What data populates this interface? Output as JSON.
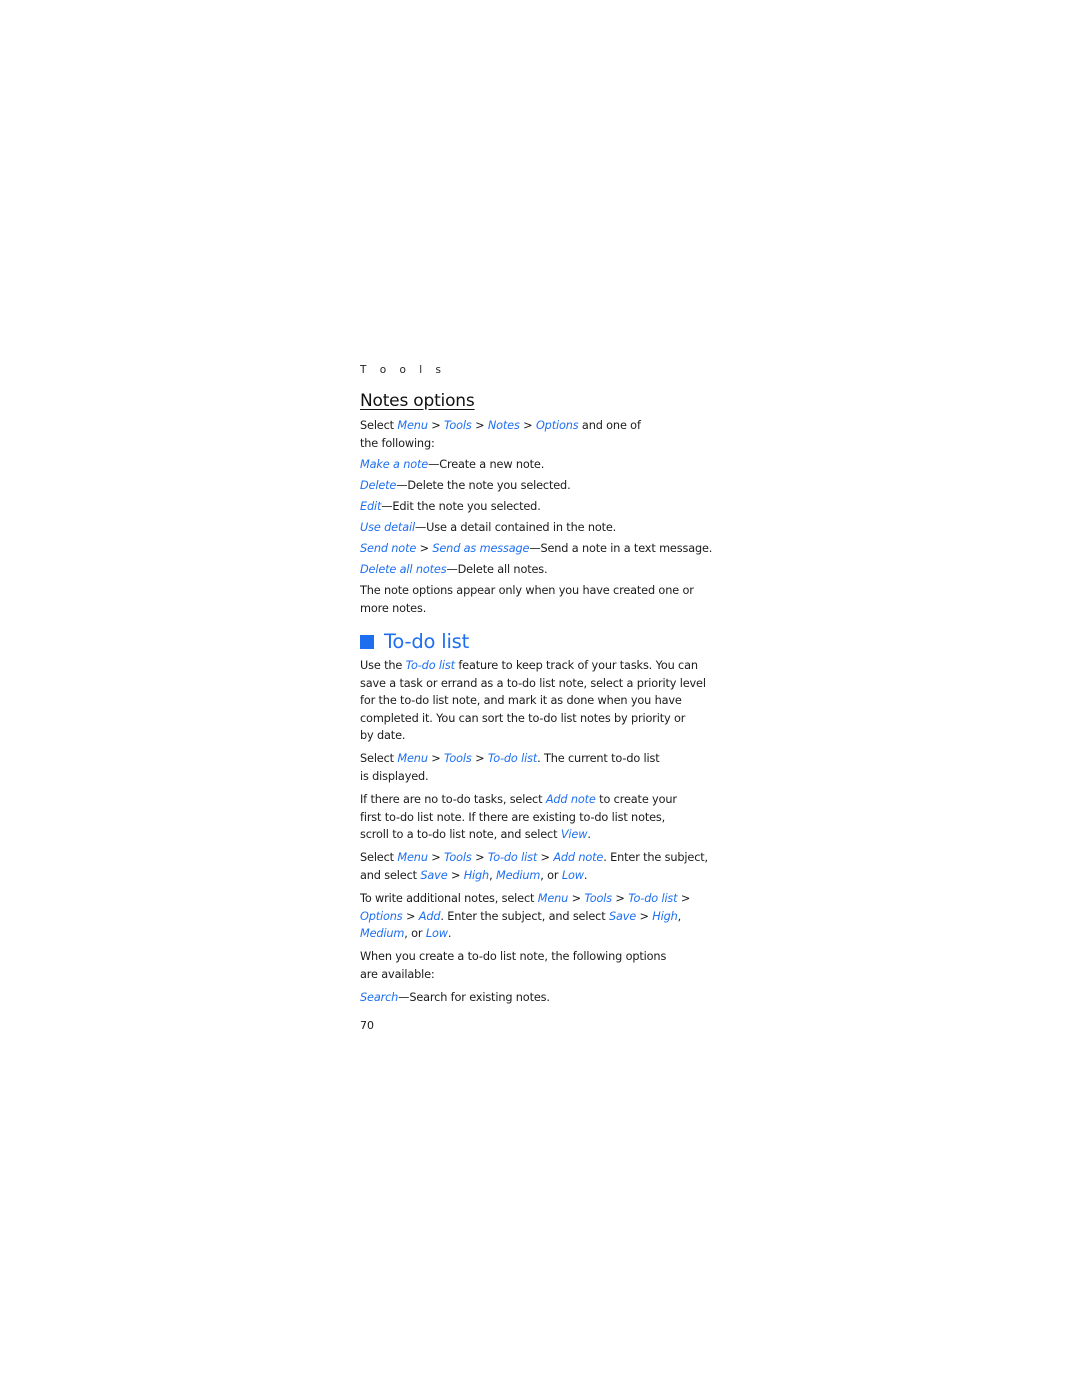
{
  "running_head": "T o o l s",
  "notes_options": {
    "heading": "Notes options",
    "intro": {
      "prefix": "Select ",
      "path": [
        "Menu",
        "Tools",
        "Notes",
        "Options"
      ],
      "suffix_line1": " and one of",
      "line2": "the following:"
    },
    "items": [
      {
        "term": "Make a note",
        "desc": "—Create a new note."
      },
      {
        "term": "Delete",
        "desc": "—Delete the note you selected."
      },
      {
        "term": "Edit",
        "desc": "—Edit the note you selected."
      },
      {
        "term": "Use detail",
        "desc": "—Use a detail contained in the note."
      },
      {
        "term": "Send note",
        "sep": " > ",
        "term2": "Send as message",
        "desc": "—Send a note in a text message."
      },
      {
        "term": "Delete all notes",
        "desc": "—Delete all notes."
      }
    ],
    "note_line1": "The note options appear only when you have created one or",
    "note_line2": "more notes."
  },
  "todo": {
    "heading": "To-do list",
    "icon": "blue-square-bullet",
    "p1": {
      "a": "Use the ",
      "link": "To-do list",
      "b": " feature to keep track of your tasks. You can",
      "l2": "save a task or errand as a to-do list note, select a priority level",
      "l3": "for the to-do list note, and mark it as done when you have",
      "l4": "completed it. You can sort the to-do list notes by priority or",
      "l5": "by date."
    },
    "p2": {
      "a": "Select ",
      "menu": "Menu",
      "tools": "Tools",
      "todo": "To-do list",
      "b": ". The current to-do list",
      "l2": "is displayed."
    },
    "p3": {
      "a": "If there are no to-do tasks, select ",
      "add": "Add note",
      "b": " to create your",
      "l2": "first to-do list note. If there are existing to-do list notes,",
      "l3a": "scroll to a to-do list note, and select ",
      "view": "View",
      "l3b": "."
    },
    "p4": {
      "a": "Select ",
      "menu": "Menu",
      "tools": "Tools",
      "todo": "To-do list",
      "add": "Add note",
      "b": ". Enter the subject,",
      "l2a": "and select ",
      "save": "Save",
      "high": "High",
      "medium": "Medium",
      "or": ", or ",
      "low": "Low",
      "end": "."
    },
    "p5": {
      "a": "To write additional notes, select ",
      "menu": "Menu",
      "tools": "Tools",
      "todo": "To-do list",
      "options": "Options",
      "add": "Add",
      "b": ". Enter the subject, and select ",
      "save": "Save",
      "high": "High",
      "medium": "Medium",
      "or": ", or ",
      "low": "Low",
      "end": "."
    },
    "p6": {
      "l1": "When you create a to-do list note, the following options",
      "l2": "are available:"
    },
    "search": {
      "term": "Search",
      "desc": "—Search for existing notes."
    }
  },
  "page_number": "70",
  "colors": {
    "accent": "#1e6ff0",
    "text": "#1a1a1a"
  }
}
